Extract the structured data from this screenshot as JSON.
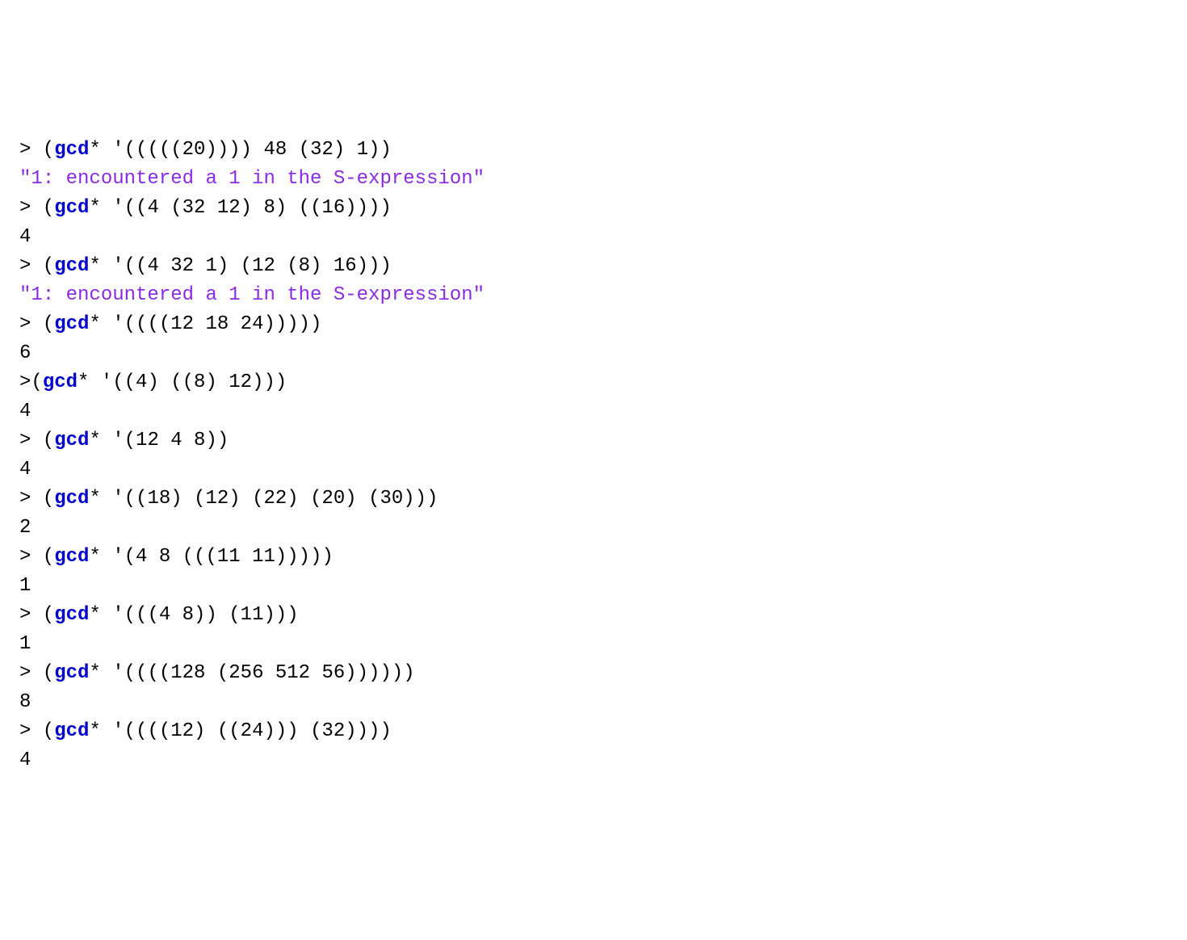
{
  "lines": [
    {
      "type": "input",
      "prefix": "> (",
      "fn": "gcd",
      "suffix": "* '(((((20)))) 48 (32) 1))"
    },
    {
      "type": "string",
      "text": "\"1: encountered a 1 in the S-expression\""
    },
    {
      "type": "input",
      "prefix": "> (",
      "fn": "gcd",
      "suffix": "* '((4 (32 12) 8) ((16))))"
    },
    {
      "type": "plain",
      "text": "4"
    },
    {
      "type": "input",
      "prefix": "> (",
      "fn": "gcd",
      "suffix": "* '((4 32 1) (12 (8) 16)))"
    },
    {
      "type": "string",
      "text": "\"1: encountered a 1 in the S-expression\""
    },
    {
      "type": "input",
      "prefix": "> (",
      "fn": "gcd",
      "suffix": "* '((((12 18 24)))))"
    },
    {
      "type": "plain",
      "text": "6"
    },
    {
      "type": "input",
      "prefix": ">(",
      "fn": "gcd",
      "suffix": "* '((4) ((8) 12)))"
    },
    {
      "type": "plain",
      "text": "4"
    },
    {
      "type": "input",
      "prefix": "> (",
      "fn": "gcd",
      "suffix": "* '(12 4 8))"
    },
    {
      "type": "plain",
      "text": "4"
    },
    {
      "type": "input",
      "prefix": "> (",
      "fn": "gcd",
      "suffix": "* '((18) (12) (22) (20) (30)))"
    },
    {
      "type": "plain",
      "text": "2"
    },
    {
      "type": "input",
      "prefix": "> (",
      "fn": "gcd",
      "suffix": "* '(4 8 (((11 11)))))"
    },
    {
      "type": "plain",
      "text": "1"
    },
    {
      "type": "input",
      "prefix": "> (",
      "fn": "gcd",
      "suffix": "* '(((4 8)) (11)))"
    },
    {
      "type": "plain",
      "text": "1"
    },
    {
      "type": "input",
      "prefix": "> (",
      "fn": "gcd",
      "suffix": "* '((((128 (256 512 56))))))"
    },
    {
      "type": "plain",
      "text": "8"
    },
    {
      "type": "input",
      "prefix": "> (",
      "fn": "gcd",
      "suffix": "* '((((12) ((24))) (32))))"
    },
    {
      "type": "plain",
      "text": "4"
    }
  ]
}
